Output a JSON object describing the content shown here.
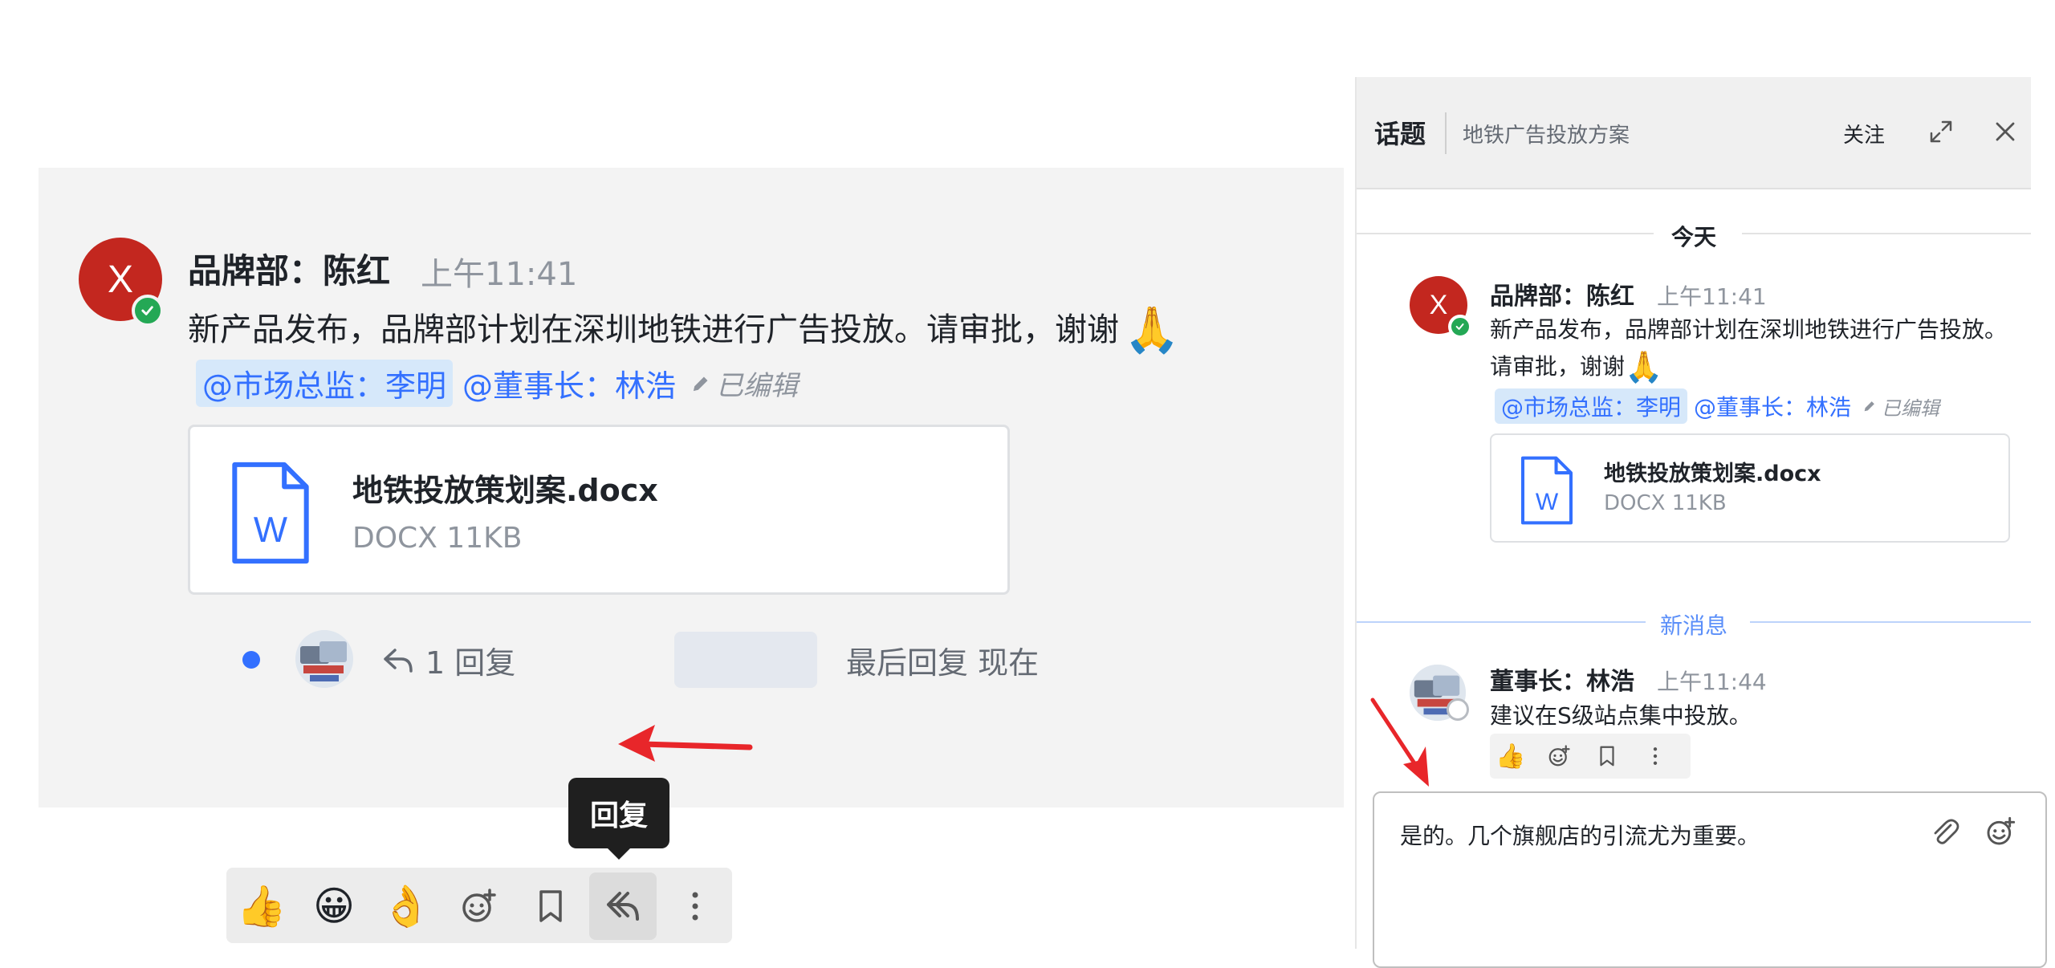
{
  "main_message": {
    "avatar_letter": "X",
    "sender": "品牌部：陈红",
    "time": "上午11:41",
    "body": "新产品发布，品牌部计划在深圳地铁进行广告投放。请审批，谢谢",
    "emoji": "🙏",
    "mention_highlight": "@市场总监：李明",
    "mention_other": "@董事长：林浩",
    "edited": "已编辑",
    "file": {
      "name": "地铁投放策划案.docx",
      "meta": "DOCX 11KB",
      "icon_letter": "W"
    },
    "reply_count": "1 回复",
    "last_reply": "最后回复 现在",
    "tooltip": "回复",
    "actions": [
      "thumbs-up",
      "grinning-face",
      "ok-hand",
      "add-reaction",
      "bookmark",
      "reply",
      "more"
    ],
    "action_emojis": {
      "thumbs_up": "👍",
      "grin": "😀",
      "ok": "👌"
    }
  },
  "topic_panel": {
    "title": "话题",
    "subject": "地铁广告投放方案",
    "follow": "关注",
    "date_divider": "今天",
    "new_divider": "新消息",
    "first_message": {
      "avatar_letter": "X",
      "sender": "品牌部：陈红",
      "time": "上午11:41",
      "body": "新产品发布，品牌部计划在深圳地铁进行广告投放。请审批，谢谢",
      "emoji": "🙏",
      "mention_highlight": "@市场总监：李明",
      "mention_other": "@董事长：林浩",
      "edited": "已编辑",
      "file": {
        "name": "地铁投放策划案.docx",
        "meta": "DOCX 11KB",
        "icon_letter": "W"
      }
    },
    "reply_message": {
      "sender": "董事长：林浩",
      "time": "上午11:44",
      "body": "建议在S级站点集中投放。",
      "thumbs_up": "👍"
    },
    "composer_text": "是的。几个旗舰店的引流尤为重要。"
  },
  "colors": {
    "accent": "#3370ff",
    "avatar_red": "#c3271f",
    "online_green": "#24a855",
    "arrow_red": "#e8262a"
  }
}
